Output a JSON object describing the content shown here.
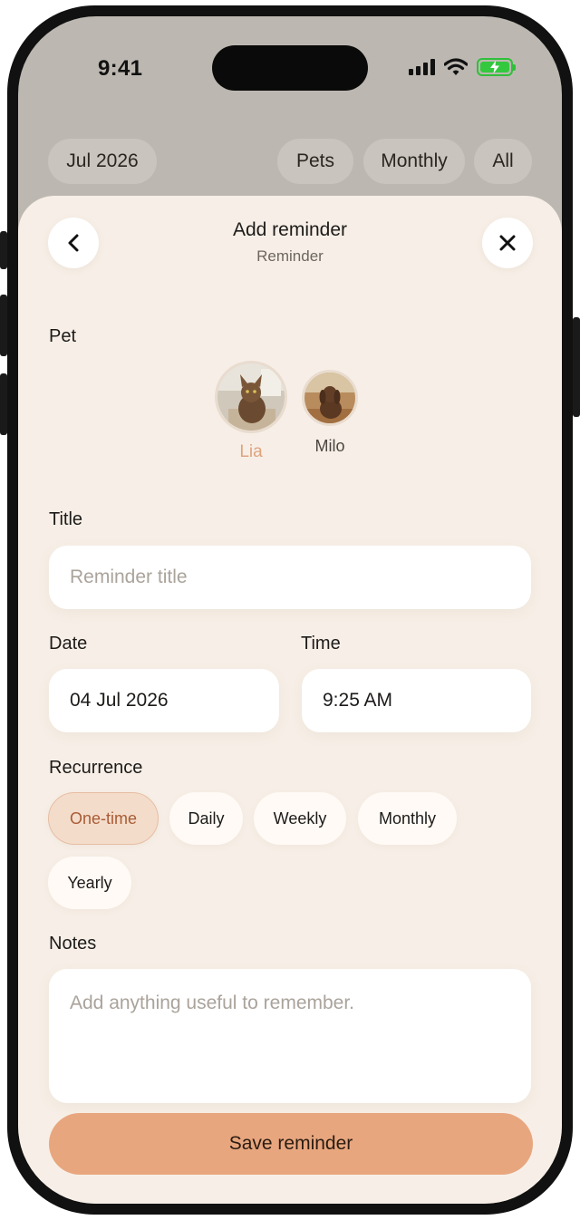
{
  "status_bar": {
    "time": "9:41"
  },
  "filters": {
    "month": "Jul 2026",
    "pets": "Pets",
    "period": "Monthly",
    "scope": "All"
  },
  "sheet": {
    "title": "Add reminder",
    "subtitle": "Reminder"
  },
  "pet_section": {
    "label": "Pet",
    "pets": [
      {
        "name": "Lia",
        "selected": true
      },
      {
        "name": "Milo",
        "selected": false
      }
    ]
  },
  "title_field": {
    "label": "Title",
    "placeholder": "Reminder title"
  },
  "date_field": {
    "label": "Date",
    "value": "04 Jul 2026"
  },
  "time_field": {
    "label": "Time",
    "value": "9:25 AM"
  },
  "recurrence": {
    "label": "Recurrence",
    "options": [
      "One-time",
      "Daily",
      "Weekly",
      "Monthly",
      "Yearly"
    ],
    "selected": "One-time"
  },
  "notes_field": {
    "label": "Notes",
    "placeholder": "Add anything useful to remember."
  },
  "save_button": {
    "label": "Save reminder"
  },
  "colors": {
    "accent": "#e8a67e",
    "selected_pet_name": "#e0a37e",
    "sheet_bg": "#f7efe7",
    "chip_active_bg": "#f4dccb"
  }
}
